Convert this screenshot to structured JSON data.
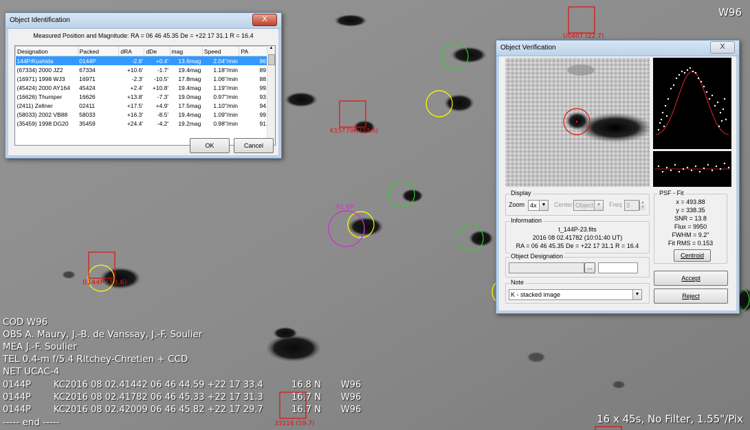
{
  "observatory_code": "W96",
  "image_info": "16 x 45s, No Filter, 1.55\"/Pix",
  "mpc_header": [
    "COD W96",
    "OBS A. Maury, J.-B. de Vanssay, J.-F. Soulier",
    "MEA J.-F. Soulier",
    "TEL 0.4-m f/5.4 Ritchey-Chretien + CCD",
    "NET UCAC-4"
  ],
  "mpc_obs": [
    "0144P        KC2016 08 02.41442 06 46 44.59 +22 17 33.4          16.8 N       W96",
    "0144P        KC2016 08 02.41782 06 46 45.33 +22 17 31.3          16.7 N       W96",
    "0144P        KC2016 08 02.42009 06 46 45.82 +22 17 29.7          16.7 N       W96"
  ],
  "mpc_end": "----- end -----",
  "markers": {
    "u0407": "U0407 (22.7)",
    "k15t79k": "K15T79K (22.5)",
    "target": "0144P (13.6)",
    "bottom": "33216 (19.7)",
    "magenta": "91.6P"
  },
  "id_dialog": {
    "title": "Object Identification",
    "close": "X",
    "measured": "Measured Position and Magnitude: RA = 06 46 45.35   De = +22 17 31.1   R = 16.4",
    "columns": [
      "Designation",
      "Packed",
      "dRA",
      "dDe",
      "mag",
      "Speed",
      "PA"
    ],
    "rows": [
      [
        "144P/Kushida",
        "0144P",
        "-2.8'",
        "+0.4'",
        "13.6mag",
        "2.04\"/min",
        "96.7°"
      ],
      [
        "(67334) 2000 JZ2",
        "67334",
        "+10.6'",
        "-1.7'",
        "19.4mag",
        "1.18\"/min",
        "89.3°"
      ],
      [
        "(16971) 1998 WJ3",
        "16971",
        "-2.3'",
        "-10.5'",
        "17.8mag",
        "1.06\"/min",
        "88.6°"
      ],
      [
        "(45424) 2000 AY164",
        "45424",
        "+2.4'",
        "+10.8'",
        "19.4mag",
        "1.19\"/min",
        "99.7°"
      ],
      [
        "(16626) Thumper",
        "16626",
        "+13.8'",
        "-7.3'",
        "19.0mag",
        "0.97\"/min",
        "93.2°"
      ],
      [
        "(2411) Zellner",
        "02411",
        "+17.5'",
        "+4.9'",
        "17.5mag",
        "1.10\"/min",
        "94.0°"
      ],
      [
        "(58033) 2002 VB88",
        "58033",
        "+16.3'",
        "-8.5'",
        "19.4mag",
        "1.09\"/min",
        "99.5°"
      ],
      [
        "(35459) 1998 DG20",
        "35459",
        "+24.4'",
        "-4.2'",
        "19.2mag",
        "0.98\"/min",
        "91.0°"
      ]
    ],
    "ok": "OK",
    "cancel": "Cancel"
  },
  "verify_dialog": {
    "title": "Object Verification",
    "close": "X",
    "display_label": "Display",
    "zoom_label": "Zoom",
    "zoom_value": "4x",
    "center_label": "Center",
    "center_value": "Object",
    "freq_label": "Freq",
    "freq_value": "3",
    "info_label": "Information",
    "info_file": "t_144P-23.fits",
    "info_time": "2016 08 02.41782 (10:01:40 UT)",
    "info_pos": "RA = 06 46 45.35   De = +22 17 31.1   R = 16.4",
    "obj_des_label": "Object Designation",
    "browse": "...",
    "note_label": "Note",
    "note_value": "K - stacked image",
    "psf_label": "PSF - Fit",
    "psf_x": "x = 493.88",
    "psf_y": "y = 338.35",
    "psf_snr": "SNR = 13.8",
    "psf_flux": "Flux = 9950",
    "psf_fwhm": "FWHM = 9.2\"",
    "psf_rms": "Fit RMS = 0.153",
    "centroid": "Centroid",
    "accept": "Accept",
    "reject": "Reject"
  }
}
